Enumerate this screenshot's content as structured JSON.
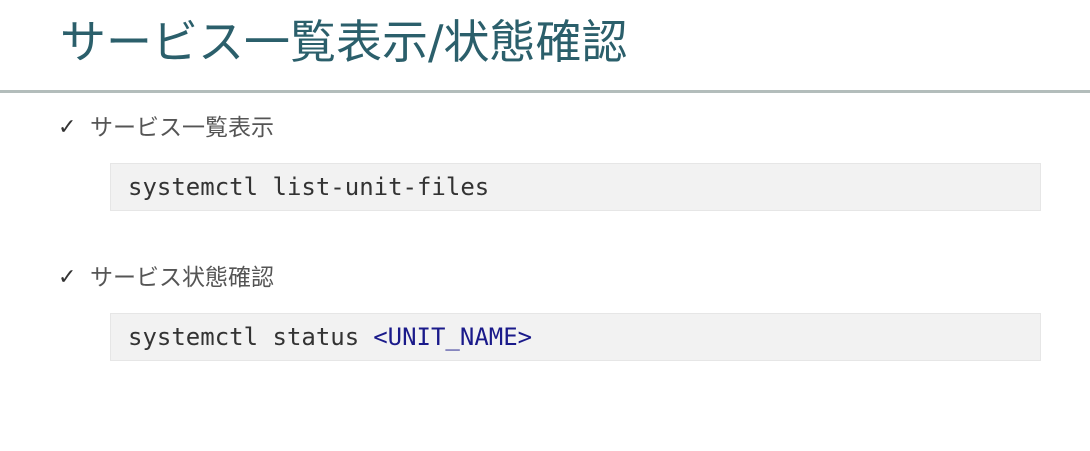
{
  "slide": {
    "title": "サービス一覧表示/状態確認",
    "sections": [
      {
        "heading": "サービス一覧表示",
        "command": "systemctl list-unit-files",
        "argument": ""
      },
      {
        "heading": "サービス状態確認",
        "command": "systemctl status",
        "argument": "<UNIT_NAME>"
      }
    ]
  },
  "icons": {
    "bullet": "check-icon"
  },
  "colors": {
    "title": "#2b5f6b",
    "rule": "#b3bdbb",
    "code_background": "#f2f2f2",
    "code_text": "#333333",
    "code_argument": "#1a1a8a"
  }
}
